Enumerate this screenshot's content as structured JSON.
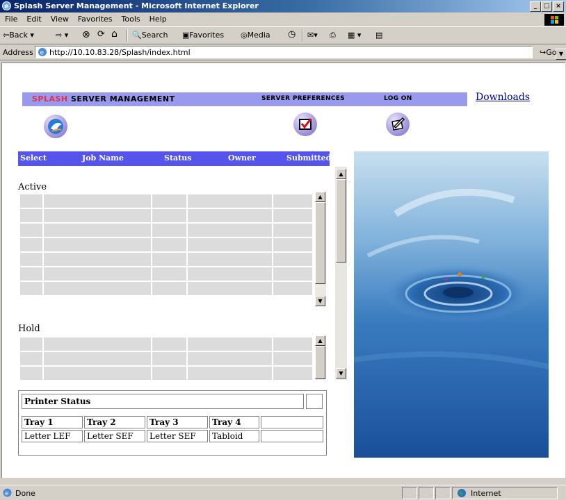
{
  "window": {
    "title": "Splash Server Management - Microsoft Internet Explorer"
  },
  "menu": [
    "File",
    "Edit",
    "View",
    "Favorites",
    "Tools",
    "Help"
  ],
  "toolbar": {
    "back": "Back",
    "search": "Search",
    "favorites": "Favorites",
    "media": "Media"
  },
  "address": {
    "label": "Address",
    "url": "http://10.10.83.28/Splash/index.html",
    "go": "Go"
  },
  "app": {
    "brand_red": "SPLASH",
    "brand_rest": " SERVER MANAGEMENT",
    "nav": {
      "preferences": "SERVER PREFERENCES",
      "logon": "LOG ON"
    },
    "downloads": "Downloads"
  },
  "job_table": {
    "columns": [
      "Select",
      "Job Name",
      "Status",
      "Owner",
      "Submitted"
    ],
    "sections": {
      "active": "Active",
      "hold": "Hold"
    }
  },
  "printer_status": {
    "title": "Printer Status",
    "trays": [
      {
        "name": "Tray 1",
        "paper": "Letter LEF"
      },
      {
        "name": "Tray 2",
        "paper": "Letter SEF"
      },
      {
        "name": "Tray 3",
        "paper": "Letter SEF"
      },
      {
        "name": "Tray 4",
        "paper": "Tabloid"
      }
    ]
  },
  "status_bar": {
    "text": "Done",
    "zone": "Internet"
  },
  "colors": {
    "nav_bar": "#9999ee",
    "table_header": "#5555ee",
    "brand_red": "#e0304a"
  }
}
